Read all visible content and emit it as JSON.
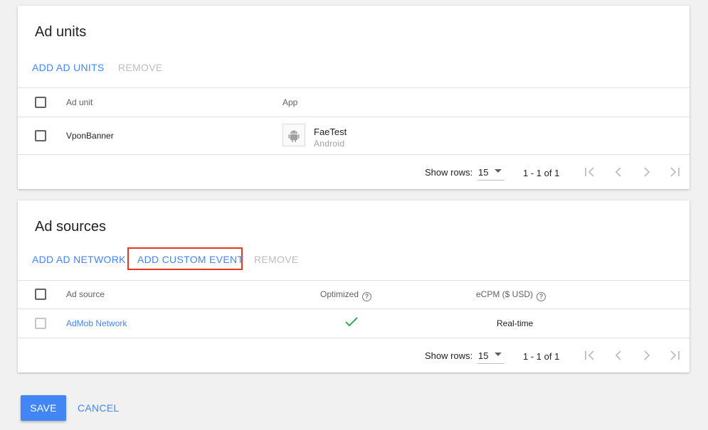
{
  "ad_units": {
    "title": "Ad units",
    "add_label": "ADD AD UNITS",
    "remove_label": "REMOVE",
    "columns": {
      "ad_unit": "Ad unit",
      "app": "App"
    },
    "rows": [
      {
        "name": "VponBanner",
        "app_name": "FaeTest",
        "platform": "Android"
      }
    ],
    "pager": {
      "show_rows_label": "Show rows:",
      "rows_value": "15",
      "range": "1 - 1 of 1"
    }
  },
  "ad_sources": {
    "title": "Ad sources",
    "add_network_label": "ADD AD NETWORK",
    "add_custom_label": "ADD CUSTOM EVENT",
    "remove_label": "REMOVE",
    "columns": {
      "ad_source": "Ad source",
      "optimized": "Optimized",
      "ecpm": "eCPM ($ USD)"
    },
    "help_glyph": "?",
    "rows": [
      {
        "name": "AdMob Network",
        "optimized": true,
        "ecpm": "Real-time"
      }
    ],
    "pager": {
      "show_rows_label": "Show rows:",
      "rows_value": "15",
      "range": "1 - 1 of 1"
    }
  },
  "footer": {
    "save_label": "SAVE",
    "cancel_label": "CANCEL"
  },
  "colors": {
    "accent": "#4285f4",
    "highlight": "#e8371c",
    "check": "#34a853",
    "disabled": "#bdbdbd"
  },
  "icons": [
    "android-icon",
    "first-page-icon",
    "prev-page-icon",
    "next-page-icon",
    "last-page-icon",
    "help-icon",
    "check-icon",
    "dropdown-caret-icon"
  ]
}
